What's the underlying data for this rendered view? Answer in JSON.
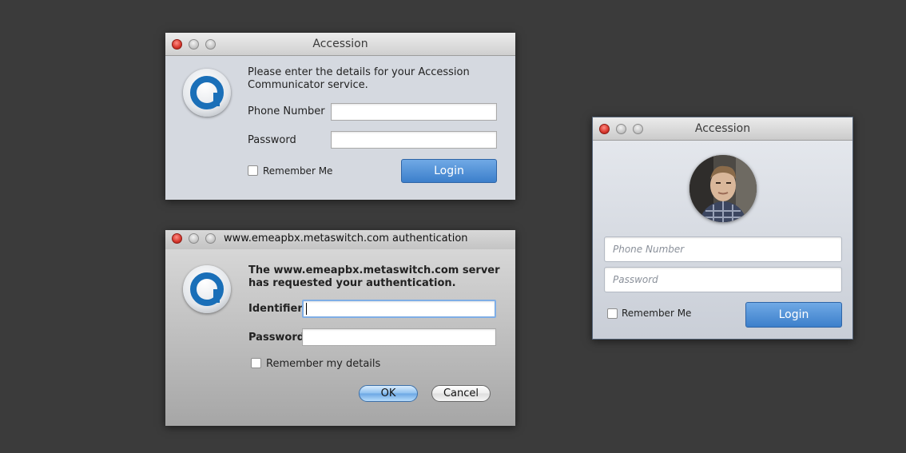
{
  "win1": {
    "title": "Accession",
    "prompt": "Please enter the details for your Accession Communicator service.",
    "phone_label": "Phone Number",
    "password_label": "Password",
    "phone_value": "",
    "password_value": "",
    "remember_label": "Remember Me",
    "login_label": "Login"
  },
  "win2": {
    "title": "www.emeapbx.metaswitch.com authentication",
    "prompt_line1": "The www.emeapbx.metaswitch.com server",
    "prompt_line2": "has requested your authentication.",
    "identifier_label": "Identifier",
    "password_label": "Password",
    "identifier_value": "",
    "password_value": "",
    "remember_label": "Remember my details",
    "ok_label": "OK",
    "cancel_label": "Cancel"
  },
  "win3": {
    "title": "Accession",
    "phone_placeholder": "Phone Number",
    "password_placeholder": "Password",
    "remember_label": "Remember Me",
    "login_label": "Login"
  },
  "icons": {
    "logo": "accession-logo-icon",
    "close": "close-icon",
    "minimize": "minimize-icon",
    "zoom": "zoom-icon",
    "avatar": "user-avatar"
  },
  "colors": {
    "desktop": "#3b3b3b",
    "window_bg": "#d5d9e0",
    "login_blue": "#3c7fcb",
    "logo_blue": "#1a6fb8"
  }
}
